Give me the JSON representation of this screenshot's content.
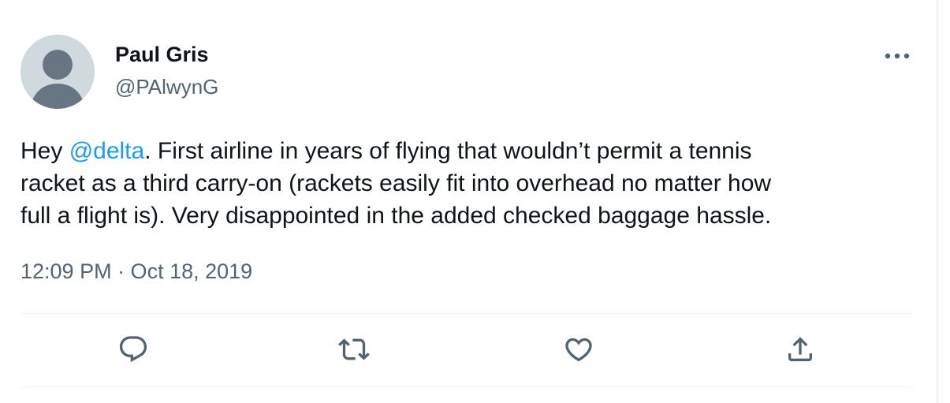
{
  "author": {
    "display_name": "Paul Gris",
    "handle": "@PAlwynG",
    "avatar_icon": "default-avatar-icon"
  },
  "tweet": {
    "lines": [
      {
        "prefix": "Hey ",
        "mention": "@delta",
        "suffix": ". First airline in years of flying that wouldn’t permit a tennis"
      },
      {
        "text": "racket as a third carry-on (rackets easily fit into overhead no matter how"
      },
      {
        "text": "full a flight is). Very disappointed in the added checked baggage hassle."
      }
    ],
    "timestamp": "12:09 PM · Oct 18, 2019"
  },
  "actions": [
    {
      "name": "reply",
      "icon": "reply-icon"
    },
    {
      "name": "retweet",
      "icon": "retweet-icon"
    },
    {
      "name": "like",
      "icon": "heart-icon"
    },
    {
      "name": "share",
      "icon": "share-icon"
    }
  ],
  "more_icon": "more-options-icon",
  "colors": {
    "text": "#0f1419",
    "secondary": "#536471",
    "link": "#1d9bf0",
    "divider": "#eff3f4",
    "avatar_bg": "#cfd9de",
    "avatar_fg": "#687684"
  }
}
